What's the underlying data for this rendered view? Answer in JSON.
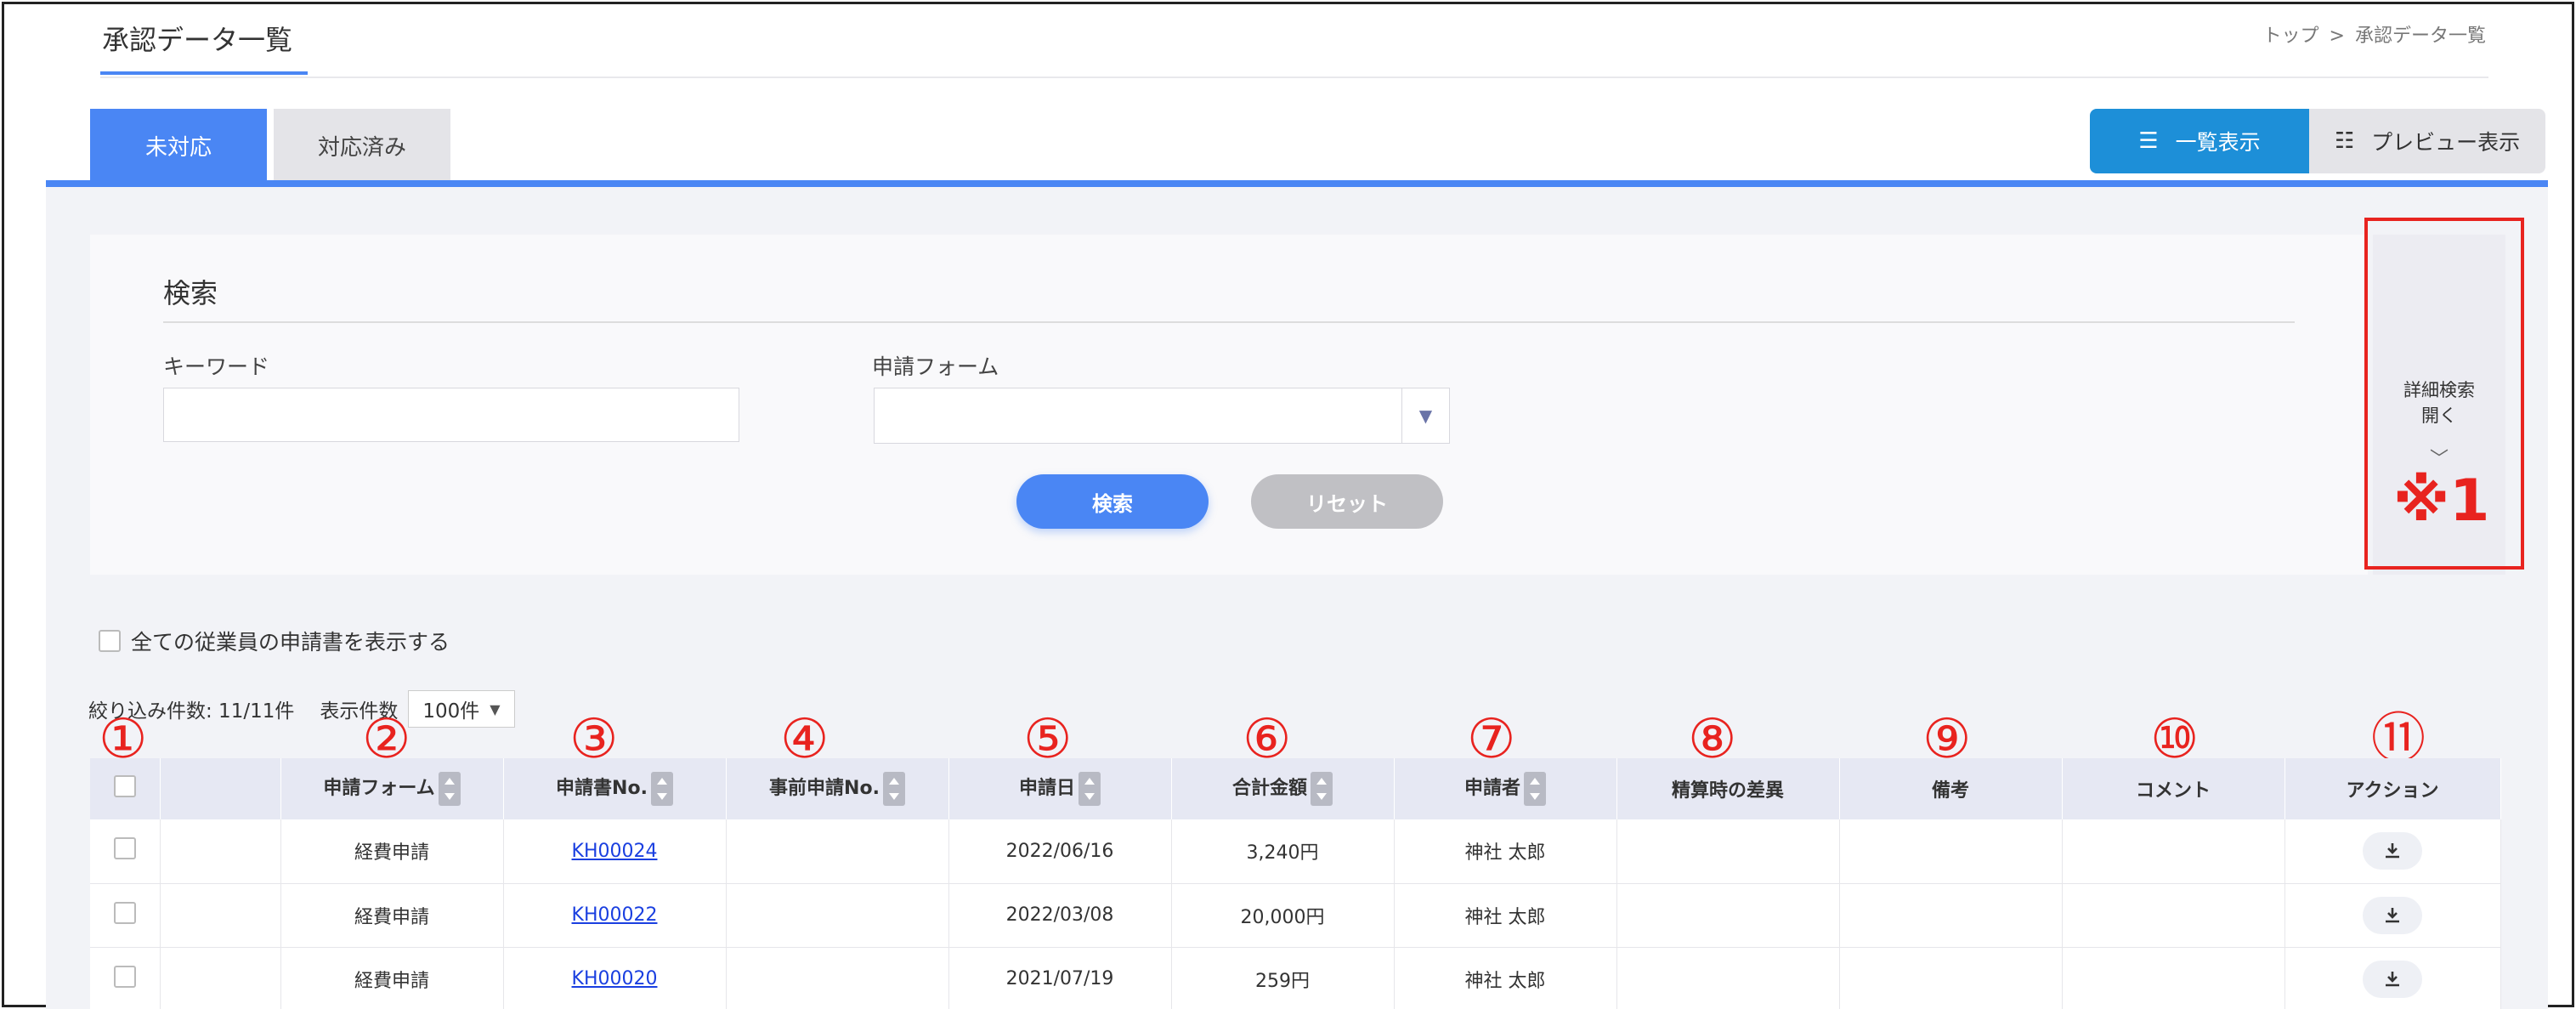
{
  "header": {
    "title": "承認データ一覧",
    "breadcrumb": [
      "トップ",
      ">",
      "承認データ一覧"
    ]
  },
  "tabs": [
    {
      "label": "未対応",
      "active": true
    },
    {
      "label": "対応済み",
      "active": false
    }
  ],
  "view_toggle": {
    "list_label": "一覧表示",
    "list_icon": "☰",
    "preview_label": "プレビュー表示",
    "preview_icon": "☷"
  },
  "search": {
    "title": "検索",
    "keyword_label": "キーワード",
    "keyword_value": "",
    "form_label": "申請フォーム",
    "form_value": "",
    "search_button": "検索",
    "reset_button": "リセット",
    "detail_line1": "詳細検索",
    "detail_line2": "開く",
    "note": "※1"
  },
  "filters": {
    "show_all_label": "全ての従業員の申請書を表示する",
    "count_text": "絞り込み件数: 11/11件",
    "per_page_label": "表示件数",
    "per_page_value": "100件"
  },
  "markers": [
    "①",
    "②",
    "③",
    "④",
    "⑤",
    "⑥",
    "⑦",
    "⑧",
    "⑨",
    "⑩",
    "⑪"
  ],
  "table": {
    "headers": [
      "申請フォーム",
      "申請書No.",
      "事前申請No.",
      "申請日",
      "合計金額",
      "申請者",
      "精算時の差異",
      "備考",
      "コメント",
      "アクション"
    ],
    "rows": [
      {
        "form": "経費申請",
        "no": "KH00024",
        "pre": "",
        "date": "2022/06/16",
        "amount": "3,240円",
        "applicant": "神社 太郎",
        "diff": "",
        "remark": "",
        "comment": ""
      },
      {
        "form": "経費申請",
        "no": "KH00022",
        "pre": "",
        "date": "2022/03/08",
        "amount": "20,000円",
        "applicant": "神社 太郎",
        "diff": "",
        "remark": "",
        "comment": ""
      },
      {
        "form": "経費申請",
        "no": "KH00020",
        "pre": "",
        "date": "2021/07/19",
        "amount": "259円",
        "applicant": "神社 太郎",
        "diff": "",
        "remark": "",
        "comment": ""
      }
    ]
  },
  "colors": {
    "accent": "#4a86f4",
    "list_view": "#1d8fd8",
    "annotation": "#e8231f"
  }
}
